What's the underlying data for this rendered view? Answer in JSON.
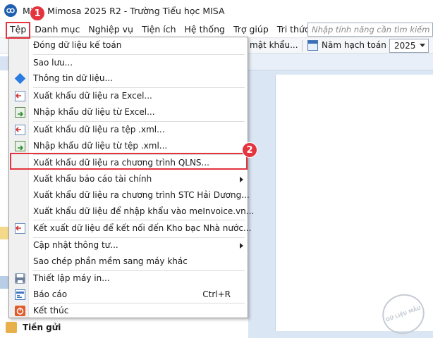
{
  "window": {
    "title": "MISA Mimosa 2025 R2 - Trường Tiểu học MISA"
  },
  "menubar": {
    "items": [
      {
        "label": "Tệp"
      },
      {
        "label": "Danh mục"
      },
      {
        "label": "Nghiệp vụ"
      },
      {
        "label": "Tiện ích"
      },
      {
        "label": "Hệ thống"
      },
      {
        "label": "Trợ giúp"
      },
      {
        "label": "Tri thức"
      }
    ],
    "search_placeholder": "Nhập tính năng cần tìm kiếm (Ctrl + F)"
  },
  "toolbar": {
    "partial_text": "mật khẩu...",
    "year_label": "Năm hạch toán",
    "year_value": "2025"
  },
  "background": {
    "bottom_item_label": "Tiền gửi"
  },
  "file_menu": {
    "items": [
      {
        "label": "Đóng dữ liệu kế toán",
        "icon": "none"
      },
      {
        "label": "Sao lưu...",
        "icon": "none"
      },
      {
        "label": "Thông tin dữ liệu...",
        "icon": "info-icon"
      },
      {
        "label": "Xuất khẩu dữ liệu ra Excel...",
        "icon": "export-excel-icon"
      },
      {
        "label": "Nhập khẩu dữ liệu từ Excel...",
        "icon": "import-excel-icon"
      },
      {
        "label": "Xuất khẩu dữ liệu ra tệp .xml...",
        "icon": "export-xml-icon"
      },
      {
        "label": "Nhập khẩu dữ liệu từ tệp .xml...",
        "icon": "import-xml-icon"
      },
      {
        "label": "Xuất khẩu dữ liệu ra chương trình QLNS...",
        "icon": "none"
      },
      {
        "label": "Xuất khẩu báo cáo tài chính",
        "icon": "none",
        "submenu": true
      },
      {
        "label": "Xuất khẩu dữ liệu ra chương trình STC Hải Dương...",
        "icon": "none"
      },
      {
        "label": "Xuất khẩu dữ liệu để nhập khẩu vào meInvoice.vn...",
        "icon": "none"
      },
      {
        "label": "Kết xuất dữ liệu để kết nối đến Kho bạc Nhà nước...",
        "icon": "export-treasury-icon"
      },
      {
        "label": "Cập nhật thông tư...",
        "icon": "none",
        "submenu": true
      },
      {
        "label": "Sao chép phần mềm sang máy khác",
        "icon": "none"
      },
      {
        "label": "Thiết lập máy in...",
        "icon": "printer-icon"
      },
      {
        "label": "Báo cáo",
        "icon": "report-icon",
        "shortcut": "Ctrl+R"
      },
      {
        "label": "Kết thúc",
        "icon": "exit-icon"
      }
    ]
  },
  "callouts": {
    "step1": "1",
    "step2": "2"
  },
  "watermark": "DỮ LIỆU MẪU",
  "colors": {
    "highlight_red": "#e4343e",
    "brand_blue": "#1f5fb0"
  }
}
